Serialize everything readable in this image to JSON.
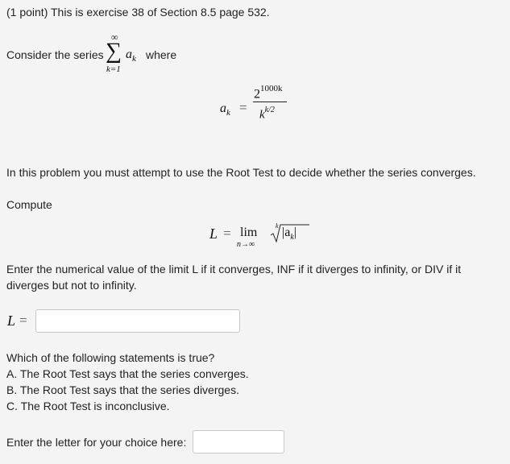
{
  "header": {
    "title": "(1 point) This is exercise 38 of Section 8.5 page 532."
  },
  "intro": {
    "prefix": "Consider the series",
    "sigma": "∑",
    "upper": "∞",
    "lower": "k=1",
    "term": "a",
    "term_sub": "k",
    "suffix": "where"
  },
  "formula": {
    "lhs": "a",
    "lhs_sub": "k",
    "eq": "=",
    "num_base": "2",
    "num_exp": "1000k",
    "den_base": "k",
    "den_exp": "k/2"
  },
  "instruction": "In this problem you must attempt to use the Root Test to decide whether the series converges.",
  "compute_label": "Compute",
  "limit_formula": {
    "lhs": "L",
    "eq": "=",
    "lim": "lim",
    "lim_sub": "n→∞",
    "root_index": "k",
    "radicand": "|a",
    "radicand_sub": "k",
    "radicand_end": "|"
  },
  "limit_instruction": {
    "line1": "Enter the numerical value of the limit L if it converges, INF if it diverges to infinity, or DIV if it",
    "line2": "diverges but not to infinity."
  },
  "answer_L": {
    "label": "L",
    "eq": "=",
    "value": "",
    "placeholder": ""
  },
  "question": {
    "prompt": "Which of the following statements is true?",
    "options": [
      "A. The Root Test says that the series converges.",
      "B. The Root Test says that the series diverges.",
      "C. The Root Test is inconclusive."
    ]
  },
  "answer_choice": {
    "label": "Enter the letter for your choice here:",
    "value": "",
    "placeholder": ""
  }
}
